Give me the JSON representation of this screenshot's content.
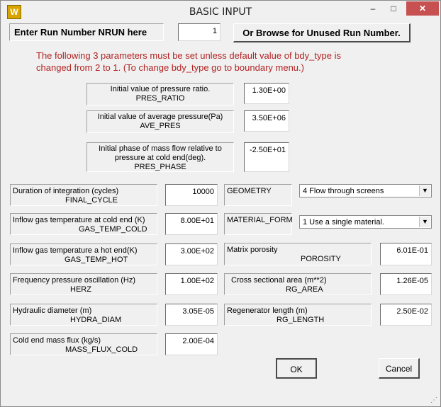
{
  "window": {
    "title": "BASIC INPUT",
    "app_icon": "W",
    "min_glyph": "–",
    "max_glyph": "□",
    "close_glyph": "✕"
  },
  "nrun": {
    "label": "Enter Run Number NRUN here",
    "value": "1",
    "browse_label": "Or Browse for Unused Run Number."
  },
  "notice": {
    "line1": "The following 3 parameters must be set unless default value of bdy_type is",
    "line2": "changed from 2 to 1.      (To change bdy_type go to boundary menu.)"
  },
  "pressure": {
    "ratio": {
      "desc": "Initial value of  pressure ratio.",
      "name": "PRES_RATIO",
      "value": "1.30E+00"
    },
    "average": {
      "desc": "Initial value of average pressure(Pa)",
      "name": "AVE_PRES",
      "value": "3.50E+06"
    },
    "phase": {
      "desc1": "Initial  phase of mass flow relative  to",
      "desc2": "pressure at cold end(deg).",
      "name": "PRES_PHASE",
      "value": "-2.50E+01"
    }
  },
  "left": {
    "final_cycle": {
      "desc": "Duration of  integration (cycles)",
      "name": "FINAL_CYCLE",
      "value": "10000"
    },
    "gas_temp_cold": {
      "desc": "Inflow gas temperature at cold end (K)",
      "name": "GAS_TEMP_COLD",
      "value": "8.00E+01"
    },
    "gas_temp_hot": {
      "desc": "Inflow gas temperature a hot end(K)",
      "name": "GAS_TEMP_HOT",
      "value": "3.00E+02"
    },
    "herz": {
      "desc": "Frequency pressure oscillation (Hz)",
      "name": "HERZ",
      "value": "1.00E+02"
    },
    "hydra_diam": {
      "desc": "Hydraulic diameter (m)",
      "name": "HYDRA_DIAM",
      "value": "3.05E-05"
    },
    "mass_flux_cold": {
      "desc": "Cold end mass flux (kg/s)",
      "name": "MASS_FLUX_COLD",
      "value": "2.00E-04"
    }
  },
  "right": {
    "geometry": {
      "name": "GEOMETRY",
      "selected": "4  Flow through screens"
    },
    "material_form": {
      "name": "MATERIAL_FORM",
      "selected": "1  Use a single material."
    },
    "porosity": {
      "desc": "Matrix porosity",
      "name": "POROSITY",
      "value": "6.01E-01"
    },
    "rg_area": {
      "desc": "Cross sectional area (m**2)",
      "name": "RG_AREA",
      "value": "1.26E-05"
    },
    "rg_length": {
      "desc": "Regenerator length  (m)",
      "name": "RG_LENGTH",
      "value": "2.50E-02"
    }
  },
  "buttons": {
    "ok": "OK",
    "cancel": "Cancel"
  },
  "icons": {
    "dropdown_arrow": "▼",
    "resize_grip": "⋰"
  }
}
